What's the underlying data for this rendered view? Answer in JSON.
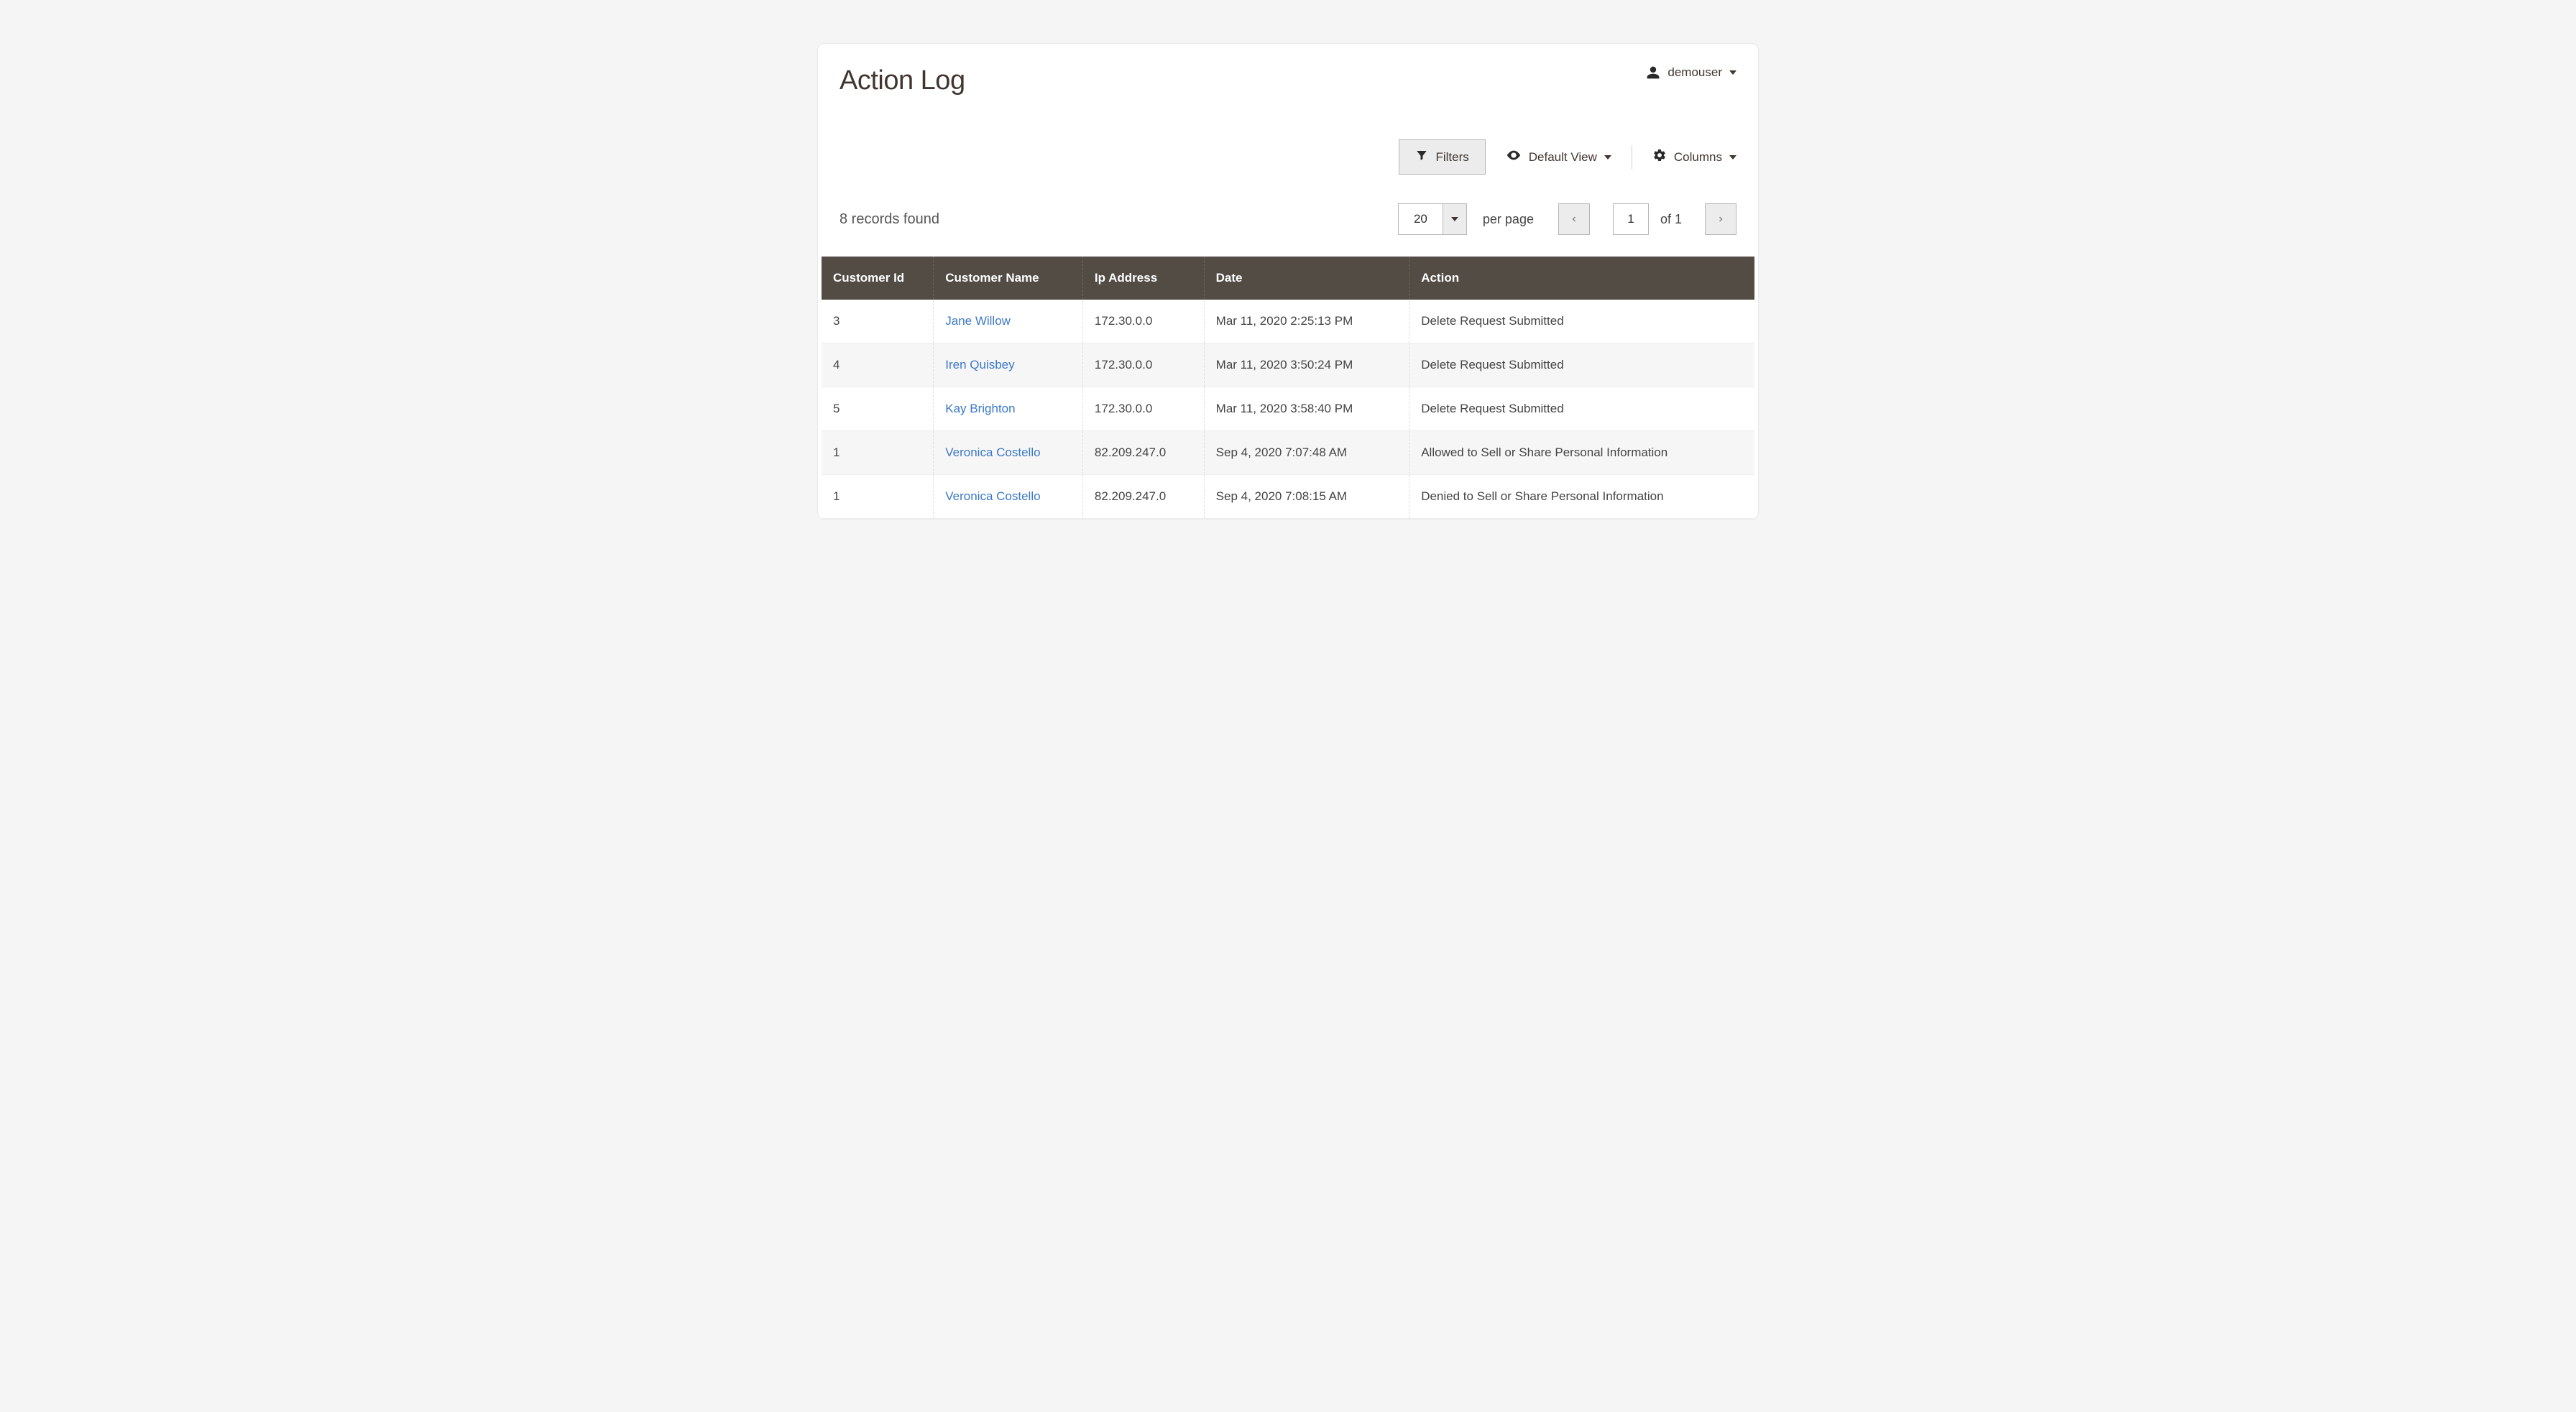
{
  "header": {
    "title": "Action Log",
    "user_name": "demouser"
  },
  "toolbar": {
    "filters_label": "Filters",
    "view_label": "Default View",
    "columns_label": "Columns"
  },
  "list": {
    "records_found": "8 records found",
    "page_size": "20",
    "per_page_label": "per page",
    "current_page": "1",
    "of_total": "of 1"
  },
  "table": {
    "headers": {
      "customer_id": "Customer Id",
      "customer_name": "Customer Name",
      "ip_address": "Ip Address",
      "date": "Date",
      "action": "Action"
    },
    "rows": [
      {
        "customer_id": "3",
        "customer_name": "Jane Willow",
        "ip_address": "172.30.0.0",
        "date": "Mar 11, 2020 2:25:13 PM",
        "action": "Delete Request Submitted"
      },
      {
        "customer_id": "4",
        "customer_name": "Iren Quisbey",
        "ip_address": "172.30.0.0",
        "date": "Mar 11, 2020 3:50:24 PM",
        "action": "Delete Request Submitted"
      },
      {
        "customer_id": "5",
        "customer_name": "Kay Brighton",
        "ip_address": "172.30.0.0",
        "date": "Mar 11, 2020 3:58:40 PM",
        "action": "Delete Request Submitted"
      },
      {
        "customer_id": "1",
        "customer_name": "Veronica Costello",
        "ip_address": "82.209.247.0",
        "date": "Sep 4, 2020 7:07:48 AM",
        "action": "Allowed to Sell or Share Personal Information"
      },
      {
        "customer_id": "1",
        "customer_name": "Veronica Costello",
        "ip_address": "82.209.247.0",
        "date": "Sep 4, 2020 7:08:15 AM",
        "action": "Denied to Sell or Share Personal Information"
      }
    ]
  }
}
